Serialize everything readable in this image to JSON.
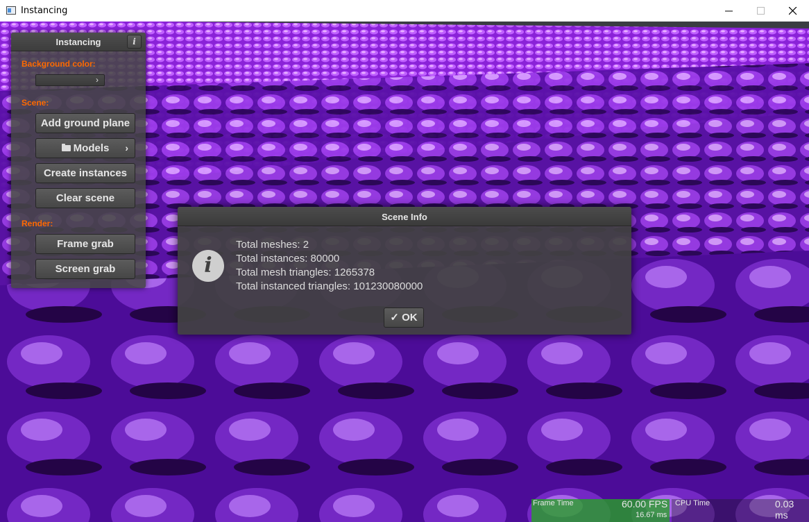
{
  "window": {
    "title": "Instancing"
  },
  "panel": {
    "title": "Instancing",
    "info_button": "i",
    "background_label": "Background color:",
    "background_chevron": "›",
    "scene_label": "Scene:",
    "add_ground_plane": "Add ground plane",
    "models": "Models",
    "models_chevron": "›",
    "create_instances": "Create instances",
    "clear_scene": "Clear scene",
    "render_label": "Render:",
    "frame_grab": "Frame grab",
    "screen_grab": "Screen grab"
  },
  "dialog": {
    "title": "Scene Info",
    "icon": "i",
    "lines": [
      "Total meshes: 2",
      "Total instances: 80000",
      "Total mesh triangles: 1265378",
      "Total instanced triangles: 101230080000"
    ],
    "ok_label": "OK",
    "ok_check": "✓"
  },
  "perf": {
    "frame_time_label": "Frame Time",
    "fps": "60.00 FPS",
    "frame_ms": "16.67 ms",
    "cpu_time_label": "CPU Time",
    "cpu_ms": "0.03 ms"
  },
  "colors": {
    "accent_label": "#ff6a00",
    "scene_purple": "#7a18c8",
    "fps_graph": "#28a028"
  },
  "icons": {
    "app": "window-app-icon",
    "minimize": "minimize-icon",
    "maximize": "maximize-icon",
    "close": "close-icon",
    "folder": "folder-icon",
    "info": "info-icon"
  }
}
